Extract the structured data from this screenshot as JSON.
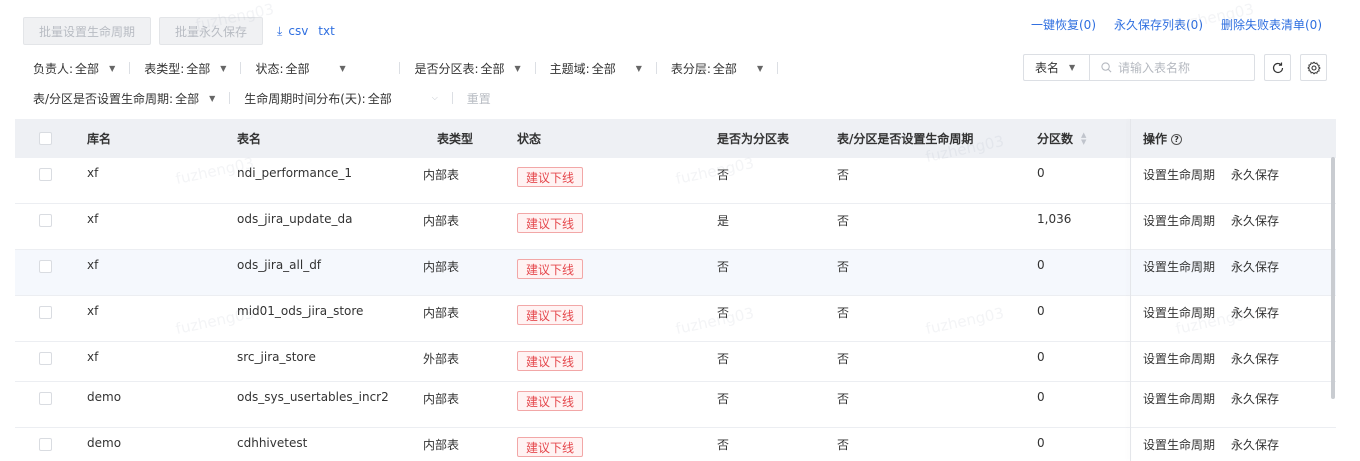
{
  "toolbar": {
    "batch_lifecycle": "批量设置生命周期",
    "batch_permanent": "批量永久保存",
    "csv": "csv",
    "txt": "txt"
  },
  "top_links": {
    "restore": "一键恢复(0)",
    "permanent_list": "永久保存列表(0)",
    "delete_failed": "删除失败表清单(0)"
  },
  "filters": {
    "row1": [
      {
        "label": "负责人:",
        "value": "全部"
      },
      {
        "label": "表类型:",
        "value": "全部"
      },
      {
        "label": "状态:",
        "value": "全部"
      },
      {
        "label": "是否分区表:",
        "value": "全部"
      },
      {
        "label": "主题域:",
        "value": "全部"
      },
      {
        "label": "表分层:",
        "value": "全部"
      }
    ],
    "row2": [
      {
        "label": "表/分区是否设置生命周期:",
        "value": "全部"
      },
      {
        "label": "生命周期时间分布(天):",
        "value": "全部"
      }
    ],
    "reset": "重置"
  },
  "search": {
    "field": "表名",
    "placeholder": "请输入表名称"
  },
  "table": {
    "headers": {
      "db": "库名",
      "table": "表名",
      "type": "表类型",
      "status": "状态",
      "partitioned": "是否为分区表",
      "lifecycle": "表/分区是否设置生命周期",
      "partitions": "分区数",
      "ops": "操作"
    },
    "rows": [
      {
        "db": "xf",
        "table": "ndi_performance_1",
        "type": "内部表",
        "status": "建议下线",
        "partitioned": "否",
        "lifecycle": "否",
        "partitions": "0",
        "op1": "设置生命周期",
        "op2": "永久保存"
      },
      {
        "db": "xf",
        "table": "ods_jira_update_da",
        "type": "内部表",
        "status": "建议下线",
        "partitioned": "是",
        "lifecycle": "否",
        "partitions": "1,036",
        "op1": "设置生命周期",
        "op2": "永久保存"
      },
      {
        "db": "xf",
        "table": "ods_jira_all_df",
        "type": "内部表",
        "status": "建议下线",
        "partitioned": "否",
        "lifecycle": "否",
        "partitions": "0",
        "op1": "设置生命周期",
        "op2": "永久保存"
      },
      {
        "db": "xf",
        "table": "mid01_ods_jira_store",
        "type": "内部表",
        "status": "建议下线",
        "partitioned": "否",
        "lifecycle": "否",
        "partitions": "0",
        "op1": "设置生命周期",
        "op2": "永久保存"
      },
      {
        "db": "xf",
        "table": "src_jira_store",
        "type": "外部表",
        "status": "建议下线",
        "partitioned": "否",
        "lifecycle": "否",
        "partitions": "0",
        "op1": "设置生命周期",
        "op2": "永久保存"
      },
      {
        "db": "demo",
        "table": "ods_sys_usertables_incr2",
        "type": "内部表",
        "status": "建议下线",
        "partitioned": "否",
        "lifecycle": "否",
        "partitions": "0",
        "op1": "设置生命周期",
        "op2": "永久保存"
      },
      {
        "db": "demo",
        "table": "cdhhivetest",
        "type": "内部表",
        "status": "建议下线",
        "partitioned": "否",
        "lifecycle": "否",
        "partitions": "0",
        "op1": "设置生命周期",
        "op2": "永久保存"
      }
    ]
  },
  "watermark": "fuzheng03",
  "colors": {
    "link": "#2f6fe0",
    "danger": "#e5484d",
    "header_bg": "#eef0f4"
  }
}
